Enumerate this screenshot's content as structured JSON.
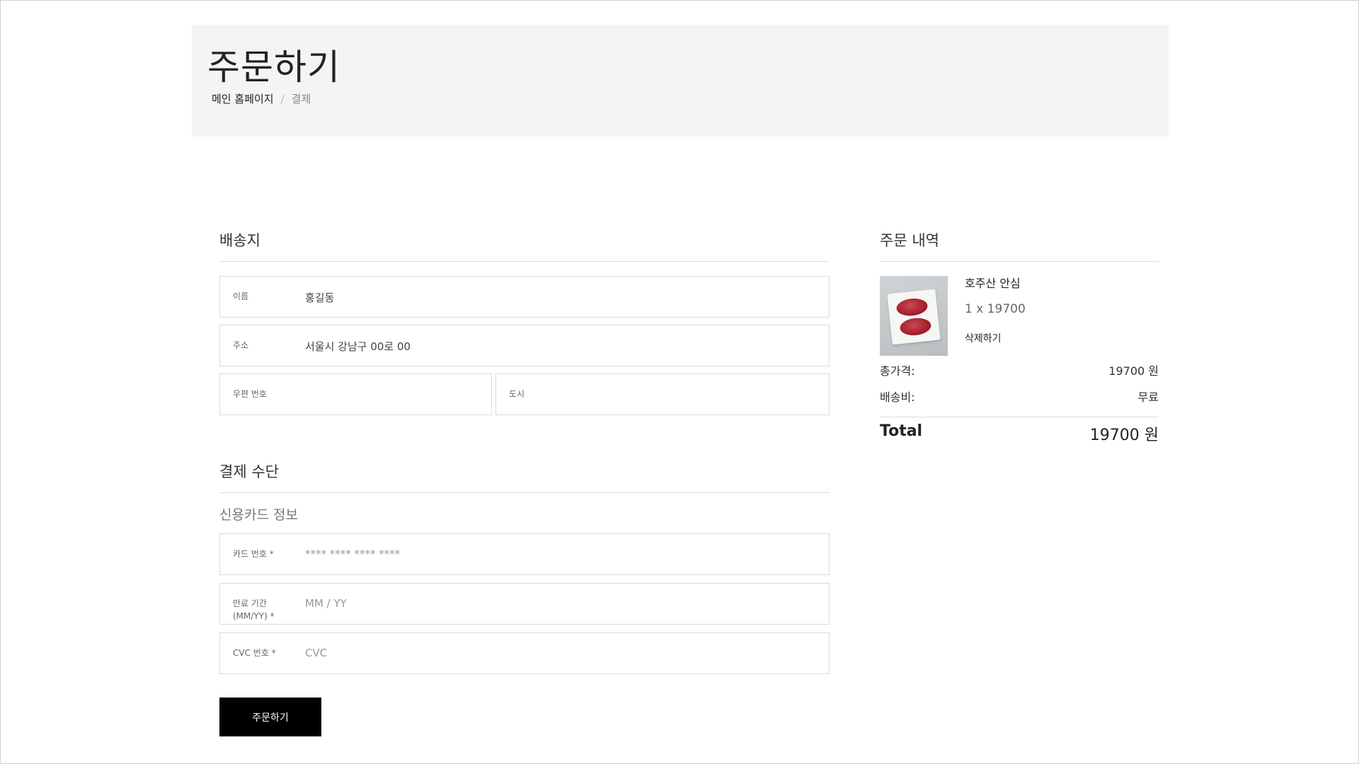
{
  "header": {
    "title": "주문하기",
    "breadcrumb": {
      "home": "메인 홈페이지",
      "separator": "/",
      "current": "결제"
    }
  },
  "shipping": {
    "title": "배송지",
    "fields": {
      "name": {
        "label": "이름",
        "value": "홍길동"
      },
      "address": {
        "label": "주소",
        "value": "서울시 강남구 00로 00"
      },
      "postal": {
        "label": "우편 번호",
        "value": ""
      },
      "city": {
        "label": "도시",
        "value": ""
      }
    }
  },
  "payment": {
    "title": "결제 수단",
    "subtitle": "신용카드 정보",
    "fields": {
      "card": {
        "label": "카드 번호 *",
        "placeholder": "**** **** **** ****"
      },
      "expiry": {
        "label_line1": "만료 기간",
        "label_line2": "(MM/YY) *",
        "placeholder": "MM / YY"
      },
      "cvc": {
        "label": "CVC 번호 *",
        "placeholder": "CVC"
      }
    },
    "submit_label": "주문하기"
  },
  "summary": {
    "title": "주문 내역",
    "item": {
      "name": "호주산 안심",
      "qty_price": "1 x 19700",
      "remove_label": "삭제하기"
    },
    "subtotal": {
      "label": "총가격:",
      "value": "19700 원"
    },
    "shipping": {
      "label": "배송비:",
      "value": "무료"
    },
    "total": {
      "label": "Total",
      "value": "19700 원"
    }
  },
  "colors": {
    "button_bg": "#000000",
    "hero_bg": "#f4f4f4",
    "border": "#dadada"
  }
}
